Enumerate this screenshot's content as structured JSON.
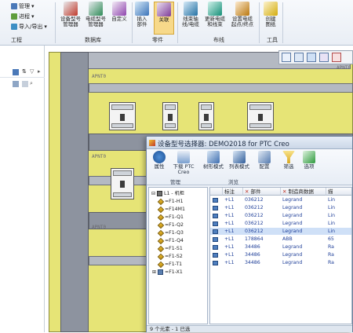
{
  "ribbon": {
    "small_buttons": [
      {
        "label": "管理",
        "icon": "manage-icon"
      },
      {
        "label": "进程",
        "icon": "process-icon"
      },
      {
        "label": "导入/导出",
        "icon": "import-export-icon"
      }
    ],
    "big_buttons": [
      {
        "label": "设备型号\n管理器",
        "icon": "device-model-manager-icon",
        "color": "#c0392b"
      },
      {
        "label": "电缆型号\n管理器",
        "icon": "cable-model-manager-icon",
        "color": "#2e8b57"
      },
      {
        "label": "自定义",
        "icon": "customize-icon",
        "color": "#8e44ad"
      },
      {
        "label": "插入\n部件",
        "icon": "insert-part-icon",
        "color": "#3b73b9"
      },
      {
        "label": "关联",
        "icon": "associate-icon",
        "color": "#7d3c98"
      },
      {
        "label": "线束轴\n线/电缆",
        "icon": "harness-axis-icon",
        "color": "#2471a3"
      },
      {
        "label": "更新电缆\n和线束",
        "icon": "update-cable-icon",
        "color": "#148f77"
      },
      {
        "label": "设置电缆\n起点/终点",
        "icon": "cable-start-end-icon",
        "color": "#b9770e"
      },
      {
        "label": "创建\n图纸",
        "icon": "create-drawing-icon",
        "color": "#d4ac0d"
      }
    ],
    "groups": [
      "工程",
      "数据库",
      "零件",
      "布线",
      "工具"
    ],
    "dropdown_arrow": "▾"
  },
  "canvas": {
    "tags": [
      "APNT0",
      "APNT0",
      "APNT0",
      "APNT0"
    ],
    "plate_color": "#e6e476",
    "rail_color": "#8d939f"
  },
  "dialog": {
    "title": "设备型号选择器: DEMO2018 for PTC Creo",
    "buttons": [
      {
        "label": "属性",
        "icon": "info-icon"
      },
      {
        "label": "下载 PTC\nCreo",
        "icon": "download-creo-icon"
      },
      {
        "label": "树形模式",
        "icon": "tree-mode-icon"
      },
      {
        "label": "列表模式",
        "icon": "list-mode-icon"
      },
      {
        "label": "配置",
        "icon": "configure-icon"
      },
      {
        "label": "筛选",
        "icon": "filter-icon"
      },
      {
        "label": "选项",
        "icon": "options-icon"
      }
    ],
    "groups": [
      "管理",
      "浏览"
    ],
    "tree": {
      "root": "L1 - 机柜",
      "children": [
        "=F1-H1",
        "=F14M1",
        "=F1-Q1",
        "=F1-Q2",
        "=F1-Q3",
        "=F1-Q4",
        "=F1-S1",
        "=F1-S2",
        "=F1-T1",
        "=F1-X1"
      ]
    },
    "grid": {
      "columns": [
        "标注",
        "部件",
        "制造商数据",
        "描"
      ],
      "rows": [
        {
          "label": "+L1",
          "part": "036212",
          "maker": "Legrand",
          "desc": "Lin"
        },
        {
          "label": "+L1",
          "part": "036212",
          "maker": "Legrand",
          "desc": "Lin"
        },
        {
          "label": "+L1",
          "part": "036212",
          "maker": "Legrand",
          "desc": "Lin"
        },
        {
          "label": "+L1",
          "part": "036212",
          "maker": "Legrand",
          "desc": "Lin"
        },
        {
          "label": "+L1",
          "part": "036212",
          "maker": "Legrand",
          "desc": "Lin"
        },
        {
          "label": "+L1",
          "part": "178864",
          "maker": "ABB",
          "desc": "65"
        },
        {
          "label": "+L1",
          "part": "34486",
          "maker": "Legrand",
          "desc": "Ra"
        },
        {
          "label": "+L1",
          "part": "34486",
          "maker": "Legrand",
          "desc": "Ra"
        },
        {
          "label": "+L1",
          "part": "34486",
          "maker": "Legrand",
          "desc": "Ra"
        }
      ],
      "selected_row": 4
    },
    "status": "9 个元素 - 1 已选"
  }
}
